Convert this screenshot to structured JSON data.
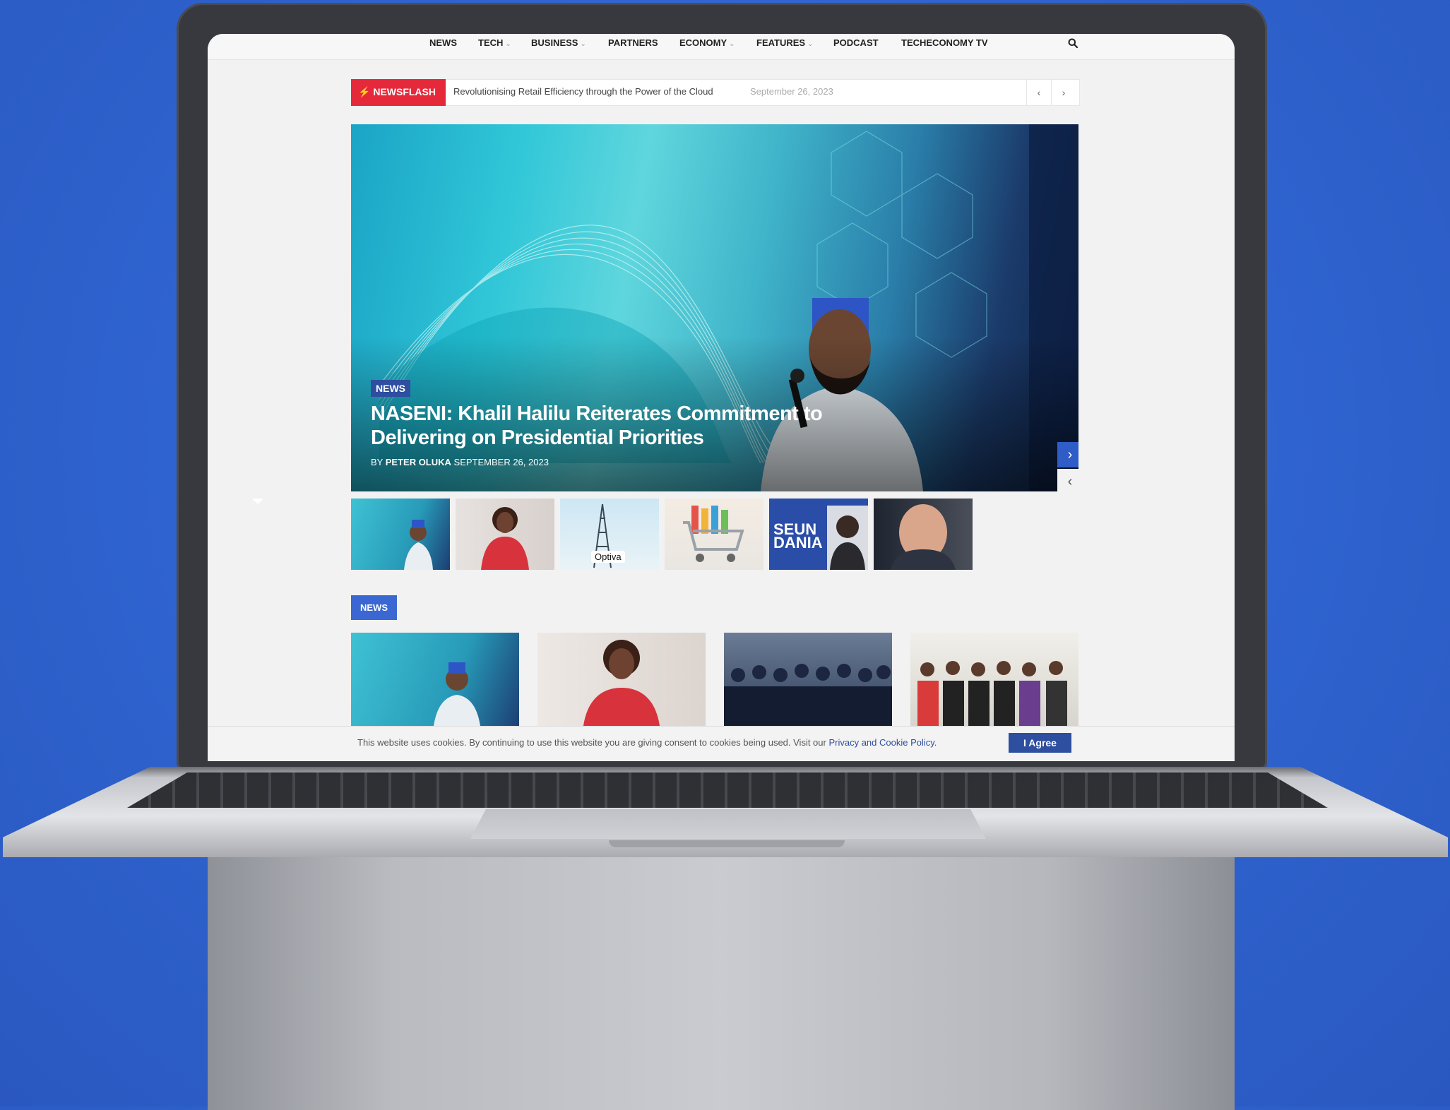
{
  "nav": {
    "items": [
      {
        "label": "NEWS",
        "has_dropdown": false
      },
      {
        "label": "TECH",
        "has_dropdown": true
      },
      {
        "label": "BUSINESS",
        "has_dropdown": true
      },
      {
        "label": "PARTNERS",
        "has_dropdown": false
      },
      {
        "label": "ECONOMY",
        "has_dropdown": true
      },
      {
        "label": "FEATURES",
        "has_dropdown": true
      },
      {
        "label": "PODCAST",
        "has_dropdown": false
      },
      {
        "label": "TECHECONOMY TV",
        "has_dropdown": false
      }
    ],
    "dropdown_caret": "⌄",
    "search_icon": "search-icon"
  },
  "newsflash": {
    "label": "NEWSFLASH",
    "headline": "Revolutionising Retail Efficiency through the Power of the Cloud",
    "date": "September 26, 2023",
    "prev": "‹",
    "next": "›",
    "accent": "#e6293a"
  },
  "hero": {
    "category": "NEWS",
    "title": "NASENI: Khalil Halilu Reiterates Commitment to Delivering on Presidential Priorities",
    "byline_prefix": "BY",
    "author": "PETER OLUKA",
    "date": "SEPTEMBER 26, 2023",
    "next": "›",
    "prev": "‹",
    "accent": "#2f5cc7"
  },
  "thumbnails": [
    {
      "id": "thumb-1",
      "caption": ""
    },
    {
      "id": "thumb-2",
      "caption": ""
    },
    {
      "id": "thumb-3",
      "caption": "Optiva"
    },
    {
      "id": "thumb-4",
      "caption": ""
    },
    {
      "id": "thumb-5",
      "caption": "SEUN DANIA"
    },
    {
      "id": "thumb-6",
      "caption": ""
    }
  ],
  "news_section": {
    "tag": "NEWS",
    "accent": "#3a67d1"
  },
  "cookie": {
    "text": "This website uses cookies. By continuing to use this website you are giving consent to cookies being used. Visit our ",
    "link": "Privacy and Cookie Policy.",
    "button": "I Agree",
    "accent": "#2e4ea0"
  }
}
